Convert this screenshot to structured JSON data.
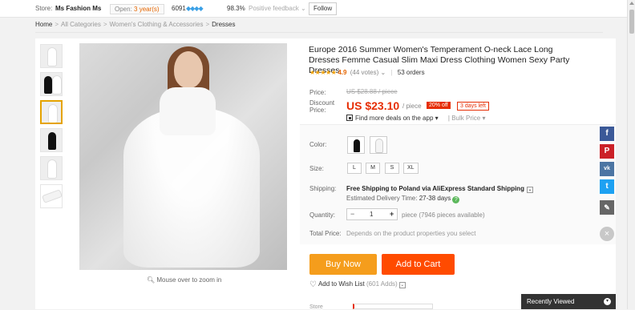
{
  "store_bar": {
    "store_label": "Store:",
    "store_name": "Ms Fashion Ms",
    "open_prefix": "Open:",
    "open_years": "3 year(s)",
    "score": "6091",
    "diamonds": "◆◆◆◆",
    "feedback_pct": "98.3%",
    "feedback_label": "Positive feedback",
    "follow_label": "Follow"
  },
  "breadcrumb": {
    "home": "Home",
    "items": [
      "All Categories",
      "Women's Clothing & Accessories"
    ],
    "current": "Dresses",
    "sep": ">"
  },
  "gallery": {
    "zoom_hint": "Mouse over to zoom in"
  },
  "product": {
    "title": "Europe 2016 Summer Women's Temperament O-neck Lace Long Dresses Femme Casual Slim Maxi Dress Clothing Women Sexy Party Dresses",
    "stars": "★★★★★",
    "rating": "4.9",
    "votes": "(44 votes)",
    "orders": "53 orders"
  },
  "price": {
    "price_label": "Price:",
    "old_price": "US $28.88 / piece",
    "discount_label": "Discount Price:",
    "current_price": "US $23.10",
    "per_piece": "/ piece",
    "discount_badge": "20% off",
    "days_left": "3 days left",
    "deals_label": "Find more deals on the app",
    "bulk_label": "Bulk Price"
  },
  "options": {
    "color_label": "Color:",
    "size_label": "Size:",
    "sizes": [
      "L",
      "M",
      "S",
      "XL"
    ]
  },
  "shipping": {
    "label": "Shipping:",
    "main": "Free Shipping to Poland via AliExpress Standard Shipping",
    "est_label": "Estimated Delivery Time:",
    "est_value": "27-38 days"
  },
  "quantity": {
    "label": "Quantity:",
    "minus": "−",
    "value": "1",
    "plus": "+",
    "info": "piece (7946 pieces available)"
  },
  "total": {
    "label": "Total Price:",
    "note": "Depends on the product properties you select"
  },
  "actions": {
    "buy_now": "Buy Now",
    "add_to_cart": "Add to Cart",
    "wishlist": "Add to Wish List",
    "wish_count": "(601 Adds)"
  },
  "store_row": {
    "label": "Store"
  },
  "social": {
    "fb": "f",
    "pin": "P",
    "vk": "vk",
    "tw": "t",
    "edit": "✎",
    "close": "×"
  },
  "recently_viewed": {
    "label": "Recently Viewed"
  }
}
